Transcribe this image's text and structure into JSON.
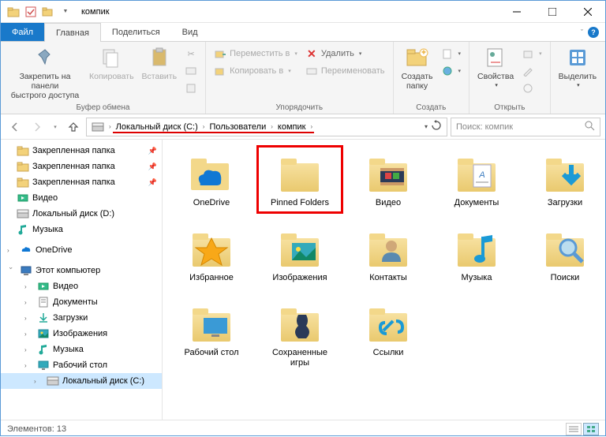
{
  "title": "компик",
  "tabs": {
    "file": "Файл",
    "home": "Главная",
    "share": "Поделиться",
    "view": "Вид"
  },
  "ribbon": {
    "clipboard": {
      "pin": "Закрепить на панели\nбыстрого доступа",
      "copy": "Копировать",
      "paste": "Вставить",
      "label": "Буфер обмена"
    },
    "organize": {
      "move": "Переместить в",
      "copyto": "Копировать в",
      "delete": "Удалить",
      "rename": "Переименовать",
      "label": "Упорядочить"
    },
    "new": {
      "newfolder": "Создать\nпапку",
      "label": "Создать"
    },
    "open": {
      "props": "Свойства",
      "label": "Открыть"
    },
    "select": {
      "select": "Выделить",
      "label": ""
    }
  },
  "breadcrumb": {
    "parts": [
      "Локальный диск (C:)",
      "Пользователи",
      "компик"
    ]
  },
  "search_placeholder": "Поиск: компик",
  "tree": {
    "quick": [
      {
        "label": "Закрепленная папка",
        "pin": true
      },
      {
        "label": "Закрепленная папка",
        "pin": true
      },
      {
        "label": "Закрепленная папка",
        "pin": true
      },
      {
        "label": "Видео",
        "icon": "video"
      },
      {
        "label": "Локальный диск (D:)",
        "icon": "drive"
      },
      {
        "label": "Музыка",
        "icon": "music"
      }
    ],
    "onedrive": "OneDrive",
    "thispc": "Этот компьютер",
    "pc_children": [
      {
        "label": "Видео",
        "icon": "video"
      },
      {
        "label": "Документы",
        "icon": "docs"
      },
      {
        "label": "Загрузки",
        "icon": "downloads"
      },
      {
        "label": "Изображения",
        "icon": "pictures"
      },
      {
        "label": "Музыка",
        "icon": "music"
      },
      {
        "label": "Рабочий стол",
        "icon": "desktop"
      },
      {
        "label": "Локальный диск (C:)",
        "icon": "drive"
      }
    ]
  },
  "items": [
    {
      "label": "OneDrive",
      "icon": "onedrive"
    },
    {
      "label": "Pinned Folders",
      "icon": "folder",
      "highlight": true
    },
    {
      "label": "Видео",
      "icon": "folder-video"
    },
    {
      "label": "Документы",
      "icon": "folder-docs"
    },
    {
      "label": "Загрузки",
      "icon": "folder-down"
    },
    {
      "label": "Избранное",
      "icon": "folder-star"
    },
    {
      "label": "Изображения",
      "icon": "folder-pic"
    },
    {
      "label": "Контакты",
      "icon": "folder-contact"
    },
    {
      "label": "Музыка",
      "icon": "folder-music"
    },
    {
      "label": "Поиски",
      "icon": "folder-search"
    },
    {
      "label": "Рабочий стол",
      "icon": "folder-desktop"
    },
    {
      "label": "Сохраненные\nигры",
      "icon": "folder-games"
    },
    {
      "label": "Ссылки",
      "icon": "folder-links"
    }
  ],
  "status": "Элементов: 13"
}
